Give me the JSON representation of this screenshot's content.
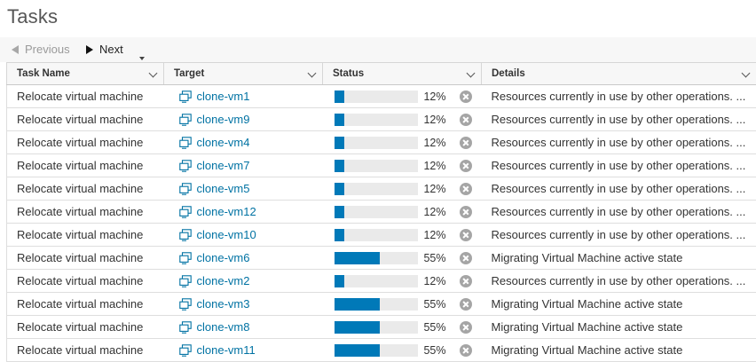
{
  "page": {
    "title": "Tasks"
  },
  "pager": {
    "previous_label": "Previous",
    "next_label": "Next"
  },
  "columns": {
    "task_name": "Task Name",
    "target": "Target",
    "status": "Status",
    "details": "Details"
  },
  "colors": {
    "link": "#0072a3",
    "progress": "#0079b8",
    "progress_track": "#eaeaea"
  },
  "rows": [
    {
      "task": "Relocate virtual machine",
      "target": "clone-vm1",
      "progress": 12,
      "percent": "12%",
      "details": "Resources currently in use by other operations. ..."
    },
    {
      "task": "Relocate virtual machine",
      "target": "clone-vm9",
      "progress": 12,
      "percent": "12%",
      "details": "Resources currently in use by other operations. ..."
    },
    {
      "task": "Relocate virtual machine",
      "target": "clone-vm4",
      "progress": 12,
      "percent": "12%",
      "details": "Resources currently in use by other operations. ..."
    },
    {
      "task": "Relocate virtual machine",
      "target": "clone-vm7",
      "progress": 12,
      "percent": "12%",
      "details": "Resources currently in use by other operations. ..."
    },
    {
      "task": "Relocate virtual machine",
      "target": "clone-vm5",
      "progress": 12,
      "percent": "12%",
      "details": "Resources currently in use by other operations. ..."
    },
    {
      "task": "Relocate virtual machine",
      "target": "clone-vm12",
      "progress": 12,
      "percent": "12%",
      "details": "Resources currently in use by other operations. ..."
    },
    {
      "task": "Relocate virtual machine",
      "target": "clone-vm10",
      "progress": 12,
      "percent": "12%",
      "details": "Resources currently in use by other operations. ..."
    },
    {
      "task": "Relocate virtual machine",
      "target": "clone-vm6",
      "progress": 55,
      "percent": "55%",
      "details": "Migrating Virtual Machine active state"
    },
    {
      "task": "Relocate virtual machine",
      "target": "clone-vm2",
      "progress": 12,
      "percent": "12%",
      "details": "Resources currently in use by other operations. ..."
    },
    {
      "task": "Relocate virtual machine",
      "target": "clone-vm3",
      "progress": 55,
      "percent": "55%",
      "details": "Migrating Virtual Machine active state"
    },
    {
      "task": "Relocate virtual machine",
      "target": "clone-vm8",
      "progress": 55,
      "percent": "55%",
      "details": "Migrating Virtual Machine active state"
    },
    {
      "task": "Relocate virtual machine",
      "target": "clone-vm11",
      "progress": 55,
      "percent": "55%",
      "details": "Migrating Virtual Machine active state"
    }
  ]
}
